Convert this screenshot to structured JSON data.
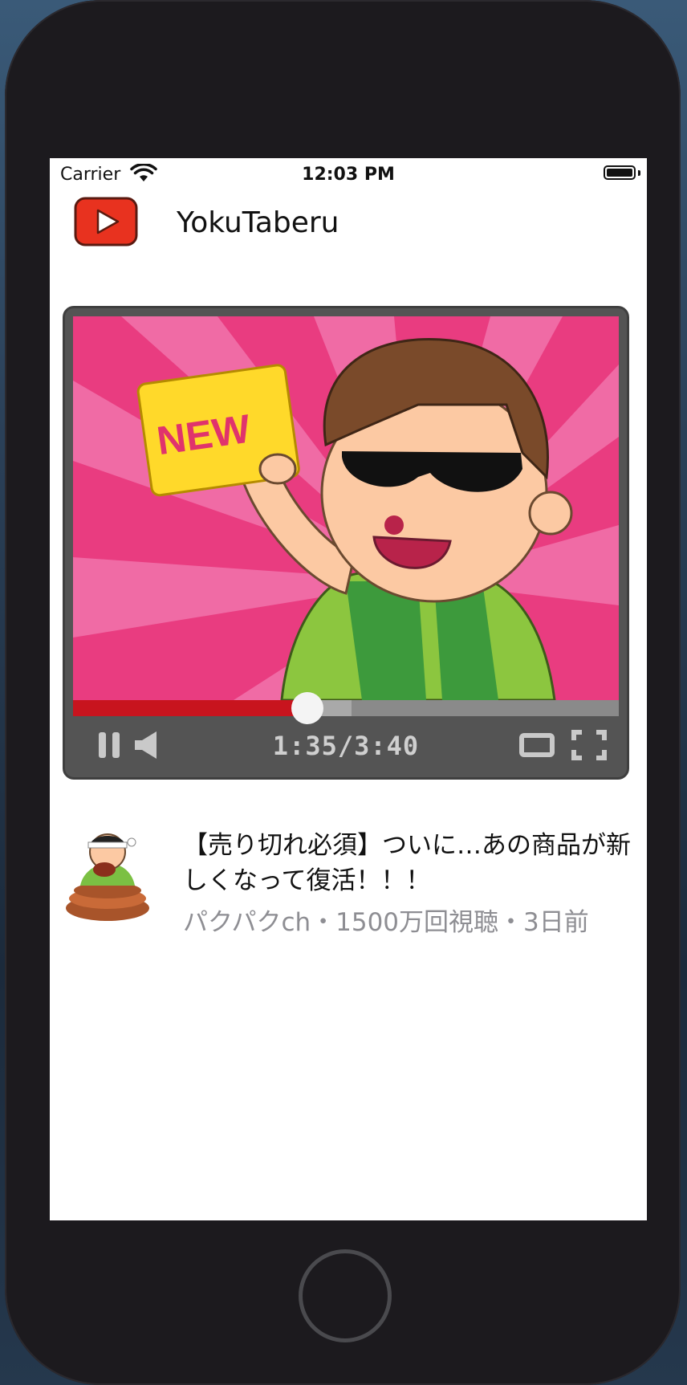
{
  "status_bar": {
    "carrier": "Carrier",
    "time": "12:03 PM",
    "wifi_icon": "wifi-icon",
    "battery_icon": "battery-icon"
  },
  "app": {
    "title": "YokuTaberu",
    "logo_icon": "play-logo-icon",
    "brand_color": "#e8321f"
  },
  "player": {
    "badge_text": "NEW",
    "timecode": "1:35/3:40",
    "progress": 0.43,
    "buffered": 0.51,
    "controls": [
      "pause-icon",
      "volume-icon",
      "theater-icon",
      "fullscreen-icon"
    ],
    "colors": {
      "progress": "#c8141e",
      "frame": "#545454",
      "background": "#ea3f82"
    }
  },
  "video": {
    "title": "【売り切れ必須】ついに…あの商品が新しくなって復活！！！",
    "meta": "パクパクch・1500万回視聴・3日前",
    "avatar_icon": "channel-avatar-icon"
  }
}
